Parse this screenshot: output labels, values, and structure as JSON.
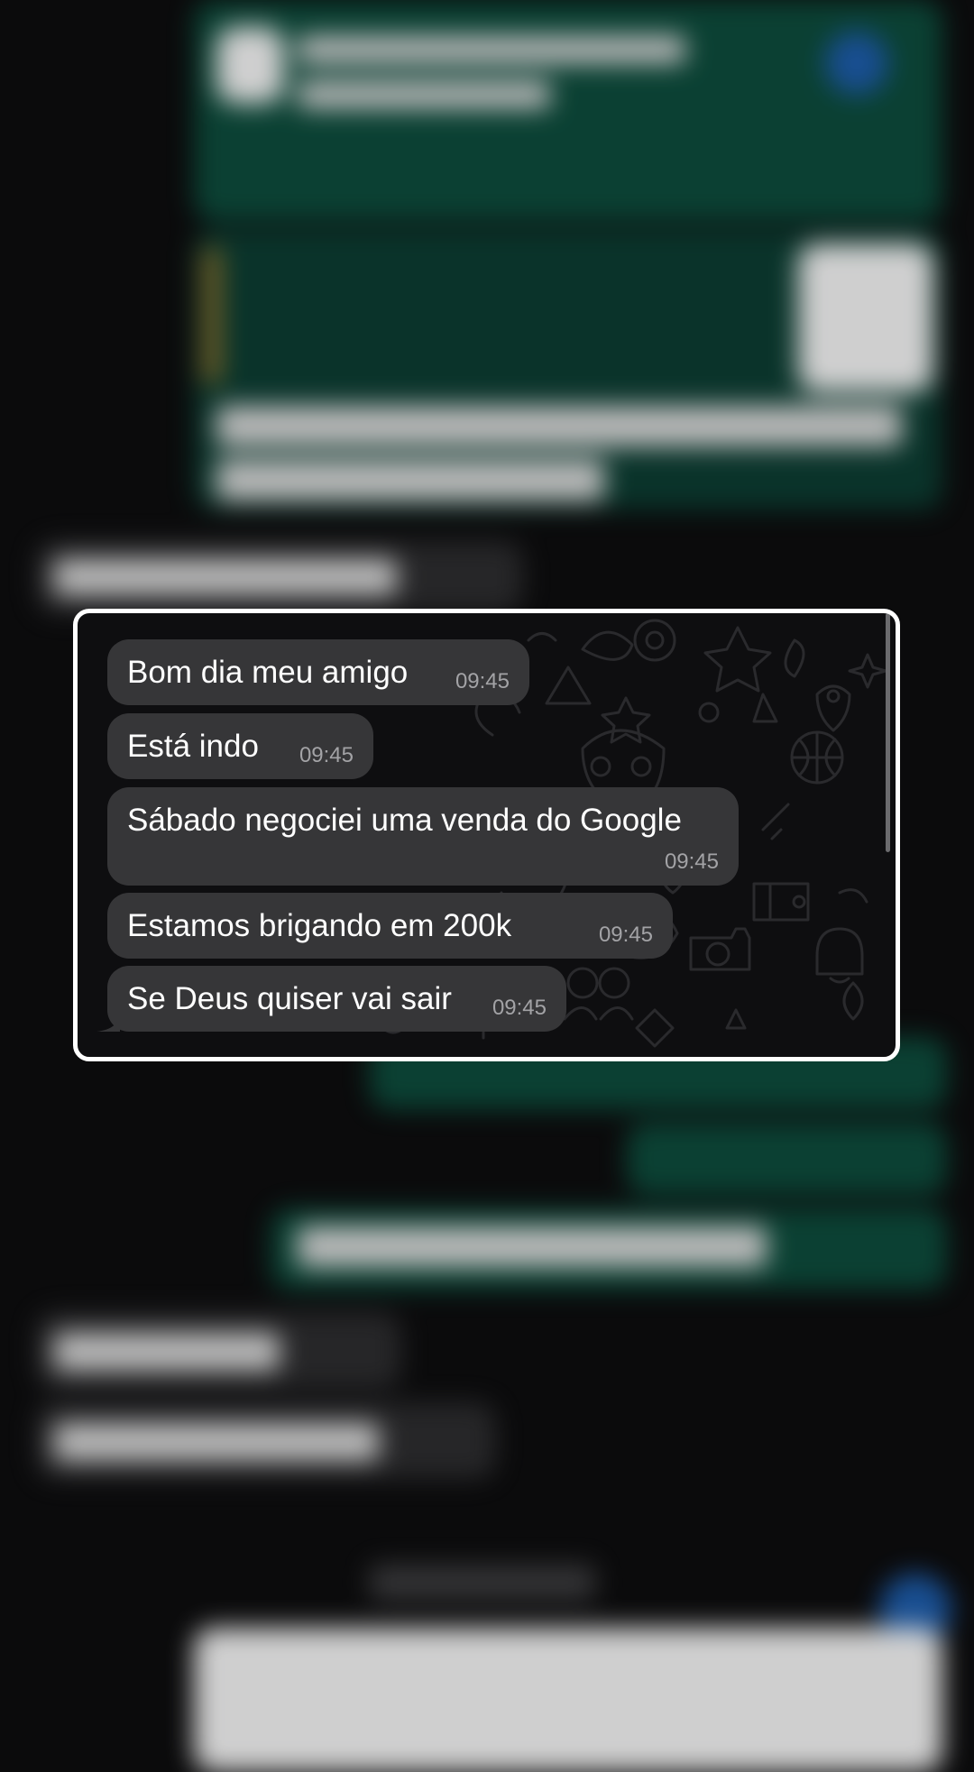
{
  "chat": {
    "messages": [
      {
        "text": "Bom dia meu amigo",
        "time": "09:45"
      },
      {
        "text": "Está indo",
        "time": "09:45"
      },
      {
        "text": "Sábado negociei uma venda do Google",
        "time": "09:45"
      },
      {
        "text": "Estamos brigando em 200k",
        "time": "09:45"
      },
      {
        "text": "Se Deus quiser vai sair",
        "time": "09:45"
      }
    ]
  },
  "colors": {
    "incoming_bubble": "#363638",
    "outgoing_bubble": "#0b4a3a",
    "timestamp": "#a3a3a6",
    "card_border": "#ffffff",
    "background": "#0b0b0c"
  },
  "icons": [
    "doodle-wallpaper-icon"
  ]
}
